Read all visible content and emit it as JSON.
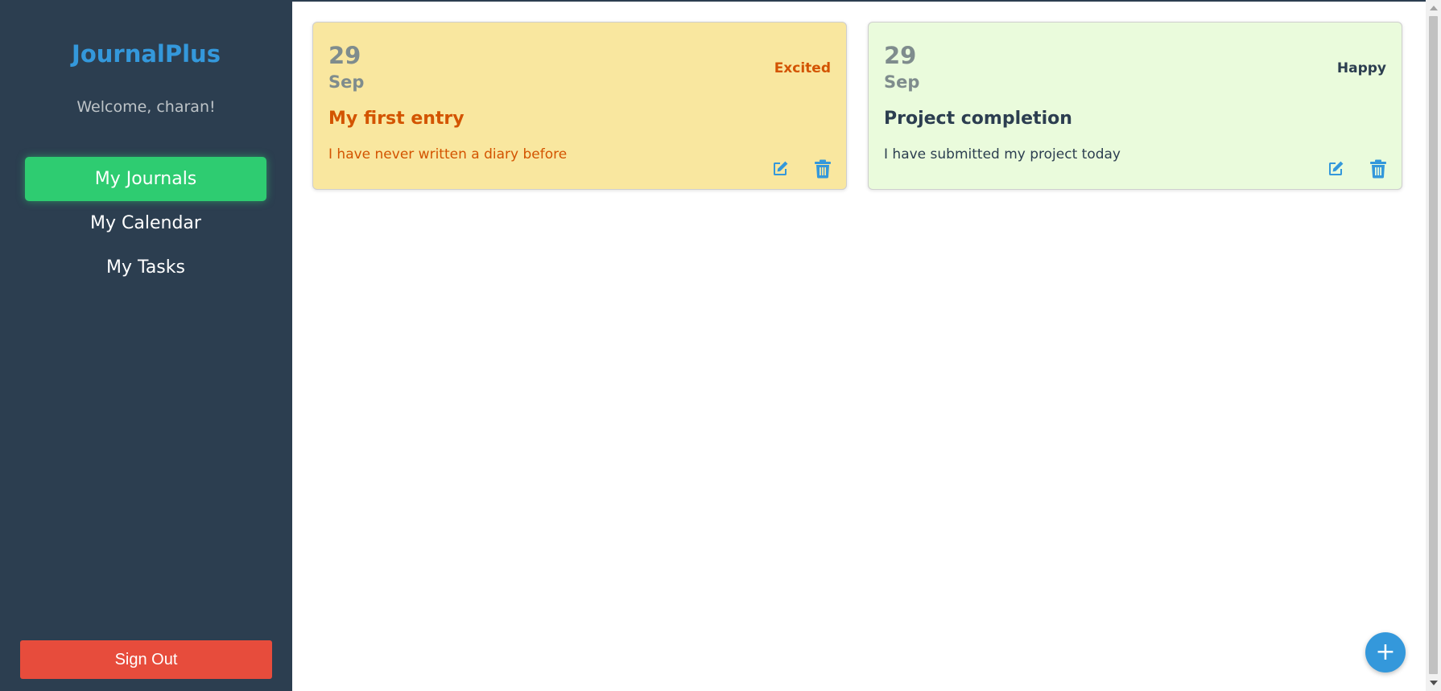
{
  "app": {
    "brand": "JournalPlus",
    "welcome": "Welcome, charan!"
  },
  "sidebar": {
    "items": [
      {
        "label": "My Journals",
        "active": true
      },
      {
        "label": "My Calendar",
        "active": false
      },
      {
        "label": "My Tasks",
        "active": false
      }
    ],
    "sign_out_label": "Sign Out"
  },
  "entries": [
    {
      "day": "29",
      "month": "Sep",
      "mood": "Excited",
      "title": "My first entry",
      "body": "I have never written a diary before",
      "background": "#f9e79f",
      "text_color": "#d35400",
      "edit_icon": "edit-icon",
      "delete_icon": "trash-icon"
    },
    {
      "day": "29",
      "month": "Sep",
      "mood": "Happy",
      "title": "Project completion",
      "body": "I have submitted my project today",
      "background": "#eafbdc",
      "text_color": "#2c3e50",
      "edit_icon": "edit-icon",
      "delete_icon": "trash-icon"
    }
  ],
  "fab": {
    "label": "+",
    "icon": "plus-icon"
  },
  "colors": {
    "sidebar_bg": "#2c3e50",
    "brand": "#3498db",
    "active_nav": "#2ecc71",
    "sign_out": "#e74c3c",
    "icon_blue": "#3498db"
  }
}
